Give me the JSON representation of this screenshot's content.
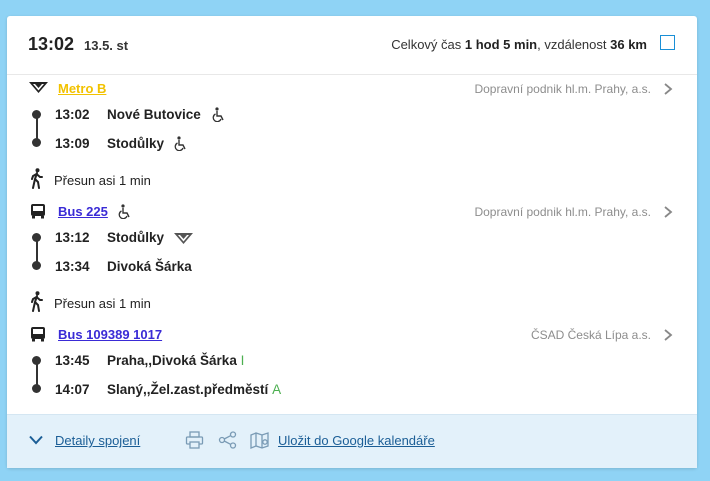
{
  "header": {
    "time": "13:02",
    "date": "13.5. st",
    "summary_prefix": "Celkový čas ",
    "duration": "1 hod 5 min",
    "summary_mid": ", vzdálenost ",
    "distance": "36 km"
  },
  "legs": [
    {
      "line": "Metro B",
      "line_color": "#f2c200",
      "operator": "Dopravní podnik hl.m. Prahy, a.s.",
      "stops": [
        {
          "time": "13:02",
          "name": "Nové Butovice"
        },
        {
          "time": "13:09",
          "name": "Stodůlky"
        }
      ]
    },
    {
      "line": "Bus 225",
      "line_color": "#3a2bd6",
      "operator": "Dopravní podnik hl.m. Prahy, a.s.",
      "stops": [
        {
          "time": "13:12",
          "name": "Stodůlky"
        },
        {
          "time": "13:34",
          "name": "Divoká Šárka"
        }
      ]
    },
    {
      "line": "Bus 109389 1017",
      "line_color": "#3a2bd6",
      "operator": "ČSAD Česká Lípa a.s.",
      "stops": [
        {
          "time": "13:45",
          "name": "Praha,,Divoká Šárka",
          "platform": "I"
        },
        {
          "time": "14:07",
          "name": "Slaný,,Žel.zast.předměstí",
          "platform": "A"
        }
      ]
    }
  ],
  "walks": [
    {
      "text": "Přesun asi 1 min"
    },
    {
      "text": "Přesun asi 1 min"
    }
  ],
  "footer": {
    "details": "Detaily spojení",
    "calendar": "Uložit do Google kalendáře"
  },
  "colors": {
    "accent": "#1a8fd6",
    "metro": "#f2c200",
    "bus": "#3a2bd6",
    "platform": "#4caf50"
  },
  "icons": [
    "metro-icon",
    "bus-icon",
    "wheelchair-icon",
    "walk-icon",
    "chevron-right-icon",
    "chevron-down-icon",
    "print-icon",
    "share-icon",
    "map-icon"
  ]
}
